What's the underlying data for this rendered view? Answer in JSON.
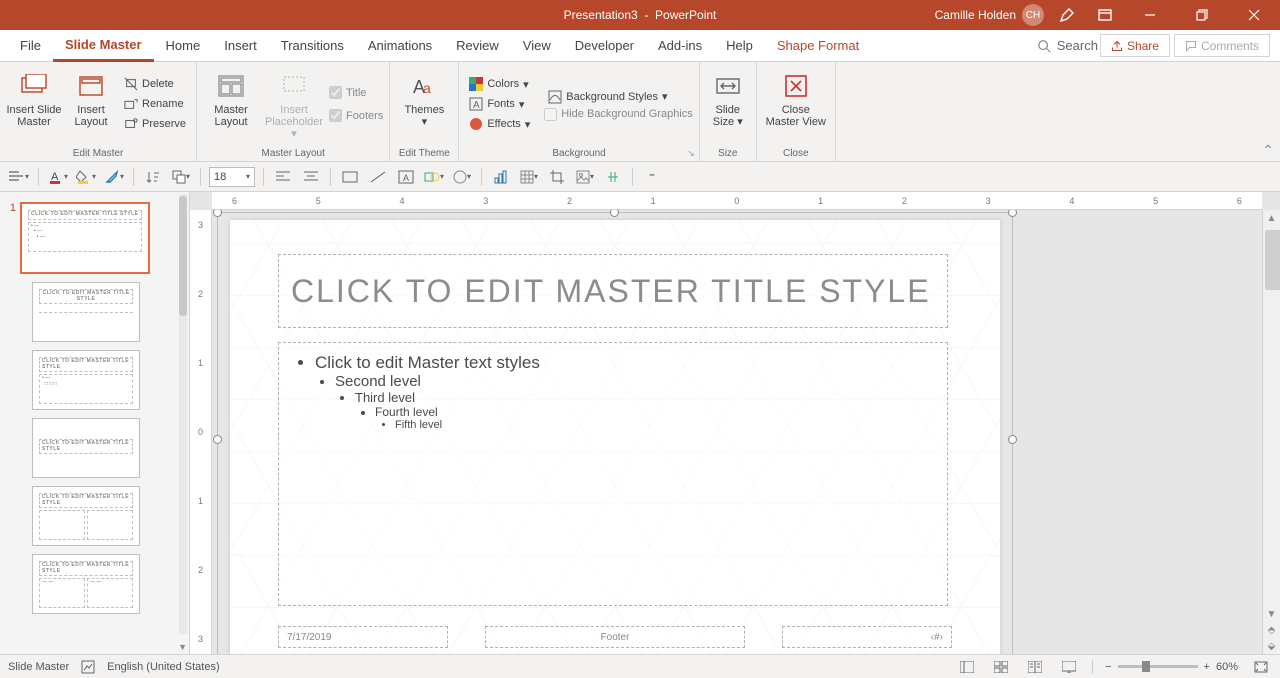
{
  "titlebar": {
    "doc": "Presentation3",
    "app": "PowerPoint",
    "user": "Camille Holden",
    "initials": "CH"
  },
  "tabs": {
    "file": "File",
    "slide_master": "Slide Master",
    "home": "Home",
    "insert": "Insert",
    "transitions": "Transitions",
    "animations": "Animations",
    "review": "Review",
    "view": "View",
    "developer": "Developer",
    "addins": "Add-ins",
    "help": "Help",
    "shape_format": "Shape Format",
    "search": "Search",
    "share": "Share",
    "comments": "Comments"
  },
  "ribbon": {
    "edit_master": {
      "insert_slide_master": "Insert Slide\nMaster",
      "insert_layout": "Insert\nLayout",
      "delete": "Delete",
      "rename": "Rename",
      "preserve": "Preserve",
      "label": "Edit Master"
    },
    "master_layout": {
      "master_layout": "Master\nLayout",
      "insert_placeholder": "Insert\nPlaceholder",
      "title": "Title",
      "footers": "Footers",
      "label": "Master Layout"
    },
    "edit_theme": {
      "themes": "Themes",
      "label": "Edit Theme"
    },
    "background": {
      "colors": "Colors",
      "fonts": "Fonts",
      "effects": "Effects",
      "bg_styles": "Background Styles",
      "hide_bg": "Hide Background Graphics",
      "label": "Background"
    },
    "size": {
      "slide_size": "Slide\nSize",
      "label": "Size"
    },
    "close": {
      "close_master": "Close\nMaster View",
      "label": "Close"
    }
  },
  "qat": {
    "font_size": "18"
  },
  "ruler": {
    "h": [
      "6",
      "5",
      "4",
      "3",
      "2",
      "1",
      "0",
      "1",
      "2",
      "3",
      "4",
      "5",
      "6"
    ],
    "v": [
      "3",
      "2",
      "1",
      "0",
      "1",
      "2",
      "3"
    ]
  },
  "slide": {
    "title_text": "Click to edit Master title style",
    "bullet1": "Click to edit Master text styles",
    "bullet2": "Second level",
    "bullet3": "Third level",
    "bullet4": "Fourth level",
    "bullet5": "Fifth level",
    "date": "7/17/2019",
    "footer": "Footer",
    "num": "‹#›"
  },
  "thumbs": {
    "index1": "1",
    "master_title": "CLICK TO EDIT MASTER TITLE STYLE"
  },
  "status": {
    "mode": "Slide Master",
    "lang": "English (United States)",
    "zoom": "60%"
  }
}
